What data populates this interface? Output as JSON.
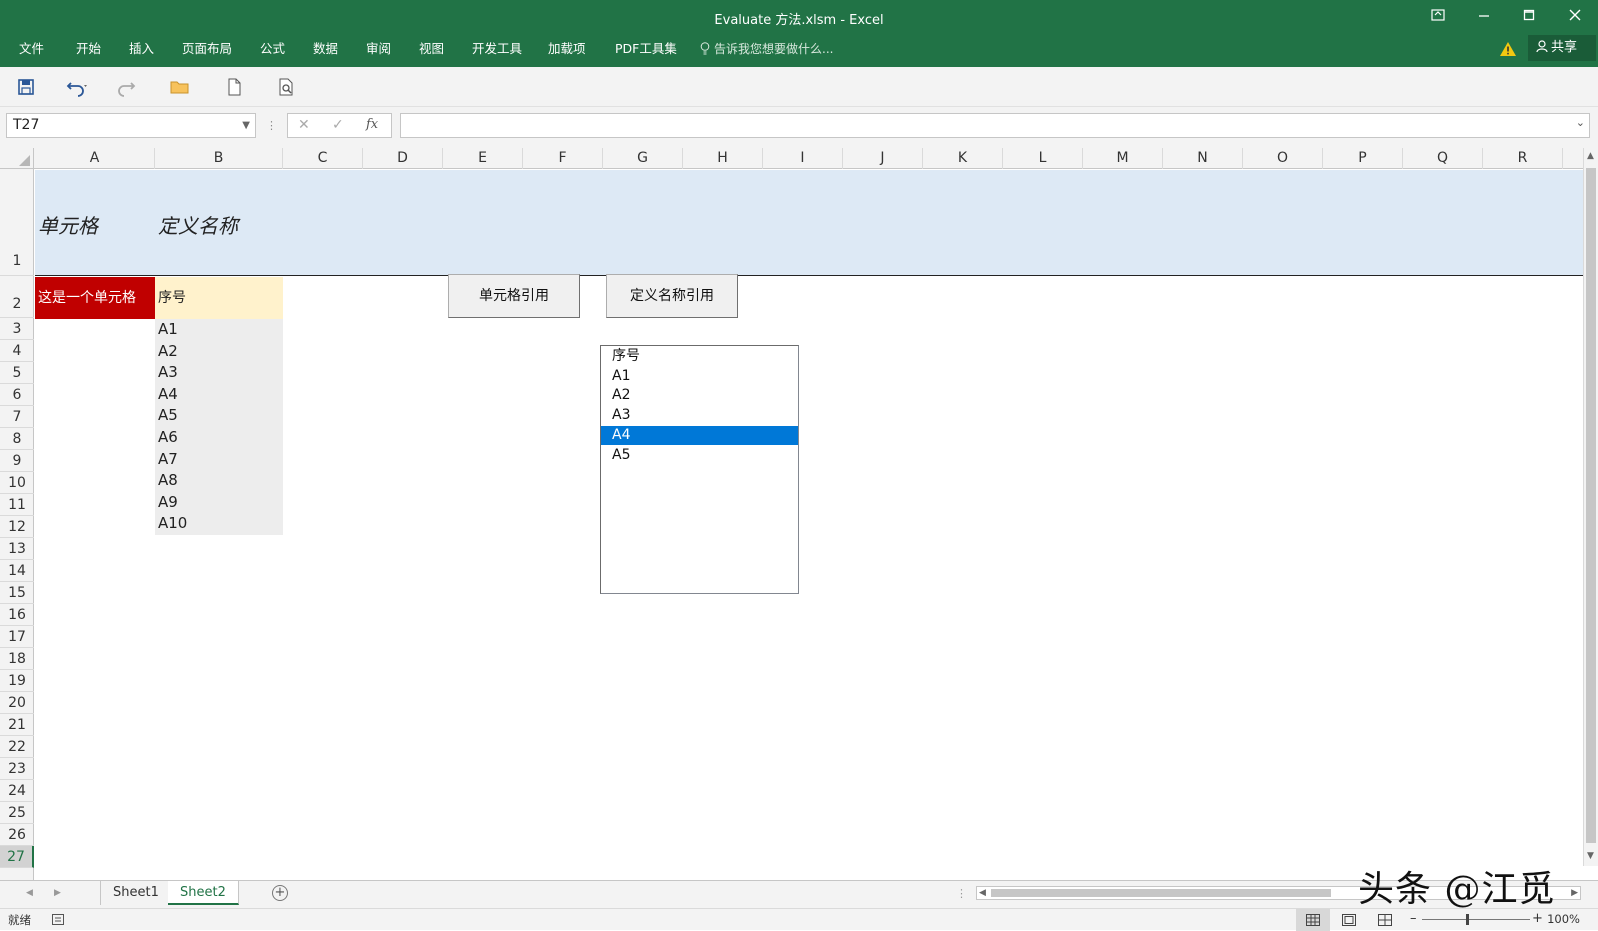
{
  "window": {
    "title": "Evaluate 方法.xlsm - Excel"
  },
  "ribbon": {
    "menu": [
      "文件",
      "开始",
      "插入",
      "页面布局",
      "公式",
      "数据",
      "审阅",
      "视图",
      "开发工具",
      "加载项",
      "PDF工具集"
    ],
    "tell_me": "告诉我您想要做什么...",
    "share_label": "共享"
  },
  "formula_bar": {
    "name_box": "T27",
    "formula": ""
  },
  "columns": [
    "A",
    "B",
    "C",
    "D",
    "E",
    "F",
    "G",
    "H",
    "I",
    "J",
    "K",
    "L",
    "M",
    "N",
    "O",
    "P",
    "Q",
    "R"
  ],
  "rows": [
    "1",
    "2",
    "3",
    "4",
    "5",
    "6",
    "7",
    "8",
    "9",
    "10",
    "11",
    "12",
    "13",
    "14",
    "15",
    "16",
    "17",
    "18",
    "19",
    "20",
    "21",
    "22",
    "23",
    "24",
    "25",
    "26",
    "27"
  ],
  "cells": {
    "A1": "单元格",
    "B1": "定义名称",
    "A2": "这是一个单元格",
    "B2": "序号",
    "B_list": [
      "A1",
      "A2",
      "A3",
      "A4",
      "A5",
      "A6",
      "A7",
      "A8",
      "A9",
      "A10"
    ]
  },
  "buttons": {
    "cell_ref": "单元格引用",
    "name_ref": "定义名称引用"
  },
  "listbox": {
    "items": [
      "序号",
      "A1",
      "A2",
      "A3",
      "A4",
      "A5"
    ],
    "selected": "A4"
  },
  "sheets": {
    "tabs": [
      "Sheet1",
      "Sheet2"
    ],
    "active": "Sheet2"
  },
  "status": {
    "ready": "就绪",
    "zoom": "100%"
  },
  "watermark": "头条 @江觅",
  "colors": {
    "ribbon": "#217346",
    "header_band": "#dde9f5",
    "red_cell": "#c00000",
    "yellow_cell": "#fff2cc",
    "selection": "#0078d7"
  }
}
